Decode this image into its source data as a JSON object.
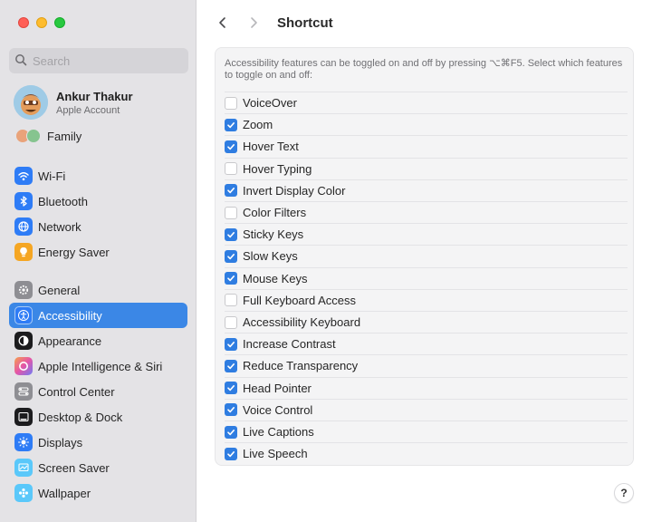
{
  "window": {
    "title": "Shortcut"
  },
  "search": {
    "placeholder": "Search"
  },
  "account": {
    "name": "Ankur Thakur",
    "subtitle": "Apple Account"
  },
  "family": {
    "label": "Family"
  },
  "sidebar": {
    "group1": [
      {
        "label": "Wi-Fi",
        "icon": "wifi-icon",
        "color": "#2e7cf6"
      },
      {
        "label": "Bluetooth",
        "icon": "bluetooth-icon",
        "color": "#2e7cf6"
      },
      {
        "label": "Network",
        "icon": "globe-icon",
        "color": "#2e7cf6"
      },
      {
        "label": "Energy Saver",
        "icon": "lightbulb-icon",
        "color": "#f5a623"
      }
    ],
    "group2": [
      {
        "label": "General",
        "icon": "gear-icon",
        "color": "#8e8e93"
      },
      {
        "label": "Accessibility",
        "icon": "accessibility-icon",
        "color": "#2e7cf6",
        "active": true
      },
      {
        "label": "Appearance",
        "icon": "appearance-icon",
        "color": "#1c1c1e"
      },
      {
        "label": "Apple Intelligence & Siri",
        "icon": "siri-icon",
        "color": "#c86fe6"
      },
      {
        "label": "Control Center",
        "icon": "control-center-icon",
        "color": "#8e8e93"
      },
      {
        "label": "Desktop & Dock",
        "icon": "dock-icon",
        "color": "#1c1c1e"
      },
      {
        "label": "Displays",
        "icon": "sun-icon",
        "color": "#2e7cf6"
      },
      {
        "label": "Screen Saver",
        "icon": "screen-saver-icon",
        "color": "#5ac8fa"
      },
      {
        "label": "Wallpaper",
        "icon": "wallpaper-icon",
        "color": "#5ac8fa"
      }
    ]
  },
  "main": {
    "description": "Accessibility features can be toggled on and off by pressing ⌥⌘F5. Select which features to toggle on and off:",
    "options": [
      {
        "label": "VoiceOver",
        "checked": false
      },
      {
        "label": "Zoom",
        "checked": true
      },
      {
        "label": "Hover Text",
        "checked": true
      },
      {
        "label": "Hover Typing",
        "checked": false
      },
      {
        "label": "Invert Display Color",
        "checked": true
      },
      {
        "label": "Color Filters",
        "checked": false
      },
      {
        "label": "Sticky Keys",
        "checked": true
      },
      {
        "label": "Slow Keys",
        "checked": true
      },
      {
        "label": "Mouse Keys",
        "checked": true
      },
      {
        "label": "Full Keyboard Access",
        "checked": false
      },
      {
        "label": "Accessibility Keyboard",
        "checked": false
      },
      {
        "label": "Increase Contrast",
        "checked": true
      },
      {
        "label": "Reduce Transparency",
        "checked": true
      },
      {
        "label": "Head Pointer",
        "checked": true
      },
      {
        "label": "Voice Control",
        "checked": true
      },
      {
        "label": "Live Captions",
        "checked": true
      },
      {
        "label": "Live Speech",
        "checked": true
      }
    ],
    "help_label": "?"
  },
  "colors": {
    "accent": "#3b87e6",
    "checkbox": "#2f7de1"
  }
}
